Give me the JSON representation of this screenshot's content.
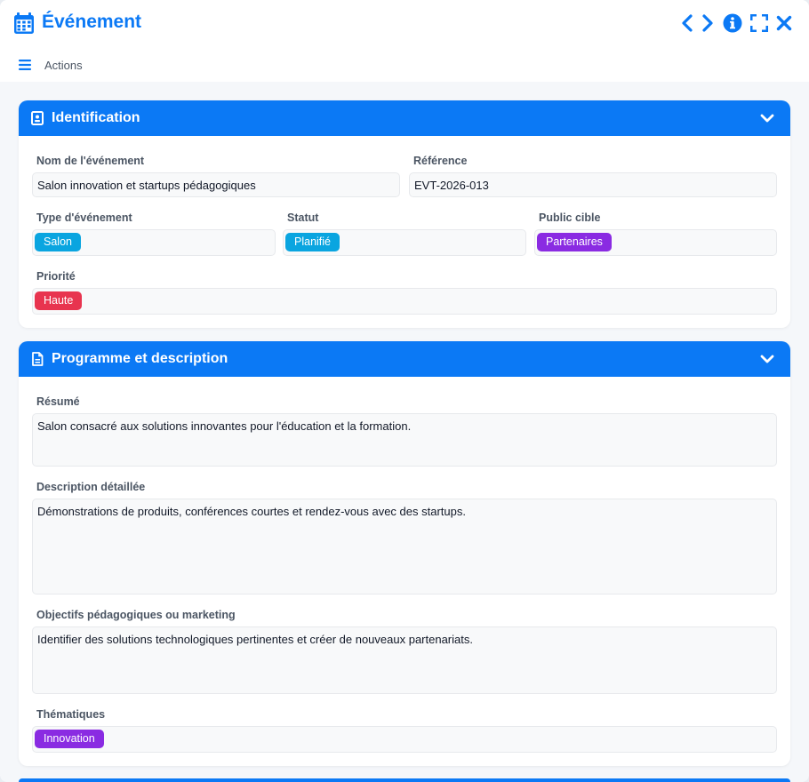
{
  "window": {
    "title": "Événement",
    "actions_label": "Actions"
  },
  "colors": {
    "brand": "#0b79f5",
    "badge_cyan": "#0aa5e0",
    "badge_purple": "#8a2be2",
    "badge_red": "#e8344f"
  },
  "identification": {
    "title": "Identification",
    "nom_label": "Nom de l'événement",
    "nom_value": "Salon innovation et startups pédagogiques",
    "reference_label": "Référence",
    "reference_value": "EVT-2026-013",
    "type_label": "Type d'événement",
    "type_value": "Salon",
    "statut_label": "Statut",
    "statut_value": "Planifié",
    "public_label": "Public cible",
    "public_value": "Partenaires",
    "priorite_label": "Priorité",
    "priorite_value": "Haute"
  },
  "programme": {
    "title": "Programme et description",
    "resume_label": "Résumé",
    "resume_value": "Salon consacré aux solutions innovantes pour l'éducation et la formation.",
    "description_label": "Description détaillée",
    "description_value": "Démonstrations de produits, conférences courtes et rendez-vous avec des startups.",
    "objectifs_label": "Objectifs pédagogiques ou marketing",
    "objectifs_value": "Identifier des solutions technologiques pertinentes et créer de nouveaux partenariats.",
    "thematiques_label": "Thématiques",
    "thematiques_value": "Innovation"
  }
}
